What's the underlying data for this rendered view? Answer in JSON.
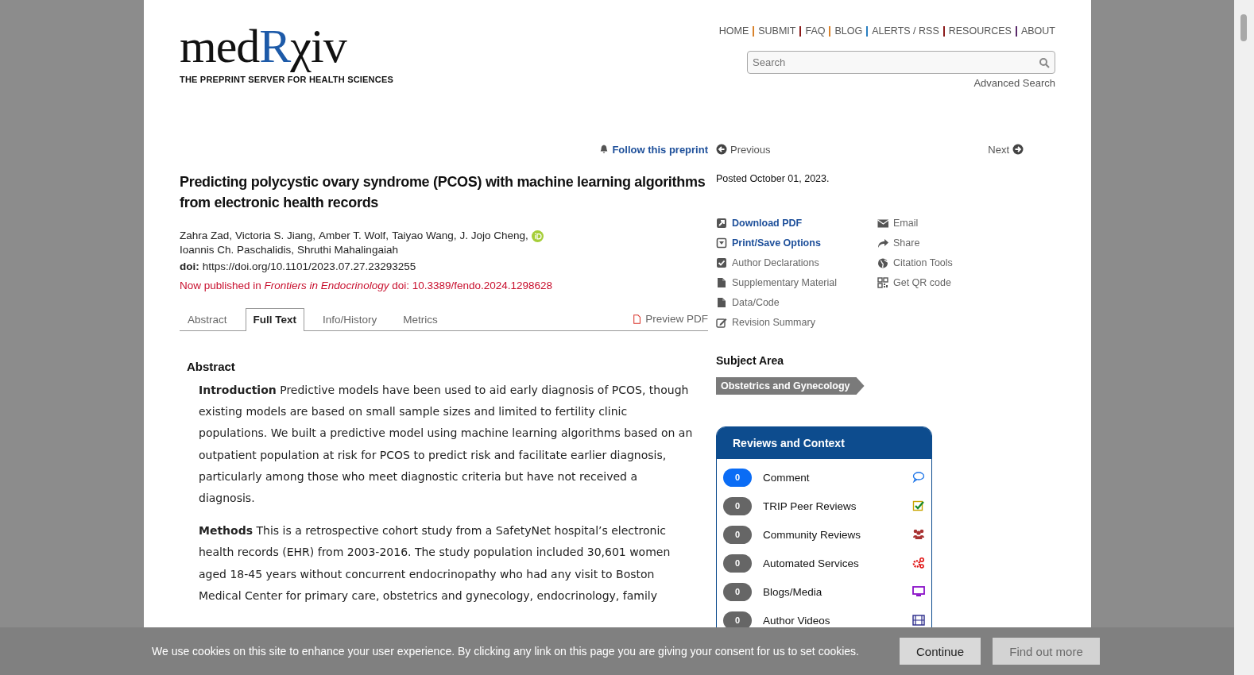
{
  "logo": {
    "before": "med",
    "highlight": "R",
    "after": "χiv",
    "tagline": "THE PREPRINT SERVER FOR HEALTH SCIENCES"
  },
  "nav": [
    "HOME",
    "SUBMIT",
    "FAQ",
    "BLOG",
    "ALERTS / RSS",
    "RESOURCES",
    "ABOUT"
  ],
  "search": {
    "placeholder": "Search",
    "advanced": "Advanced Search"
  },
  "article_nav": {
    "follow": "Follow this preprint",
    "previous": "Previous",
    "next": "Next"
  },
  "article": {
    "title": "Predicting polycystic ovary syndrome (PCOS) with machine learning algorithms from electronic health records",
    "authors": [
      {
        "name": "Zahra Zad,",
        "orcid": false
      },
      {
        "name": "Victoria S. Jiang,",
        "orcid": false
      },
      {
        "name": "Amber T. Wolf,",
        "orcid": false
      },
      {
        "name": "Taiyao Wang,",
        "orcid": false
      },
      {
        "name": "J. Jojo Cheng,",
        "orcid": true
      },
      {
        "name": "Ioannis Ch. Paschalidis,",
        "orcid": false
      },
      {
        "name": "Shruthi Mahalingaiah",
        "orcid": false
      }
    ],
    "doi_label": "doi:",
    "doi": "https://doi.org/10.1101/2023.07.27.23293255",
    "published": "Now published in *Frontiers in Endocrinology* doi: 10.3389/fendo.2024.1298628",
    "tabs": [
      {
        "label": "Abstract",
        "selected": false
      },
      {
        "label": "Full Text",
        "selected": true
      },
      {
        "label": "Info/History",
        "selected": false
      },
      {
        "label": "Metrics",
        "selected": false
      }
    ],
    "preview_pdf": "Preview PDF",
    "abstract": {
      "heading": "Abstract",
      "paragraphs": [
        "**Introduction** Predictive models have been used to aid early diagnosis of PCOS, though existing models are based on small sample sizes and limited to fertility clinic populations. We built a predictive model using machine learning algorithms based on an outpatient population at risk for PCOS to predict risk and facilitate earlier diagnosis, particularly among those who meet diagnostic criteria but have not received a diagnosis.",
        "**Methods** This is a retrospective cohort study from a SafetyNet hospital’s electronic health records (EHR) from 2003-2016. The study population included 30,601 women aged 18-45 years without concurrent endocrinopathy who had any visit to Boston Medical Center for primary care, obstetrics and gynecology, endocrinology, family"
      ]
    }
  },
  "sidebar": {
    "posted": "Posted October 01, 2023.",
    "actions_left": [
      {
        "label": "Download PDF",
        "primary": true
      },
      {
        "label": "Print/Save Options",
        "primary": true
      },
      {
        "label": "Author Declarations",
        "primary": false
      },
      {
        "label": "Supplementary Material",
        "primary": false
      },
      {
        "label": "Data/Code",
        "primary": false
      },
      {
        "label": "Revision Summary",
        "primary": false
      }
    ],
    "actions_right": [
      {
        "label": "Email",
        "primary": false
      },
      {
        "label": "Share",
        "primary": false
      },
      {
        "label": "Citation Tools",
        "primary": false
      },
      {
        "label": "Get QR code",
        "primary": false
      }
    ],
    "subject_heading": "Subject Area",
    "subject_tag": "Obstetrics and Gynecology",
    "reviews": {
      "title": "Reviews and Context",
      "items": [
        {
          "count": "0",
          "label": "Comment",
          "highlighted": true
        },
        {
          "count": "0",
          "label": "TRIP Peer Reviews",
          "highlighted": false
        },
        {
          "count": "0",
          "label": "Community Reviews",
          "highlighted": false
        },
        {
          "count": "0",
          "label": "Automated Services",
          "highlighted": false
        },
        {
          "count": "0",
          "label": "Blogs/Media",
          "highlighted": false
        },
        {
          "count": "0",
          "label": "Author Videos",
          "highlighted": false
        }
      ]
    }
  },
  "cookie": {
    "text": "We use cookies on this site to enhance your user experience. By clicking any link on this page you are giving your consent for us to set cookies.",
    "buttons": [
      {
        "label": "Continue",
        "kind": "primary"
      },
      {
        "label": "Find out more",
        "kind": "secondary"
      }
    ]
  }
}
